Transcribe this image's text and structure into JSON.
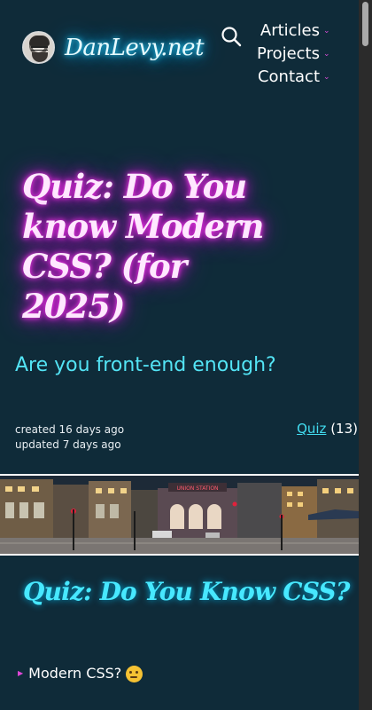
{
  "header": {
    "site_name": "DanLevy.net",
    "avatar_alt": "avatar",
    "nav": [
      {
        "label": "Articles"
      },
      {
        "label": "Projects"
      },
      {
        "label": "Contact"
      }
    ]
  },
  "hero": {
    "title": "Quiz: Do You know Modern CSS? (for 2025)",
    "subtitle": "Are you front-end enough?",
    "created": "created 16 days ago",
    "updated": "updated 7 days ago",
    "tag_label": "Quiz",
    "tag_count": "(13)"
  },
  "content": {
    "section_title": "Quiz: Do You Know CSS?",
    "list": [
      {
        "label": "Modern CSS?",
        "emoji": "thinking-face-icon"
      }
    ]
  },
  "colors": {
    "background": "#0f2b39",
    "accent_cyan": "#47e8ff",
    "accent_pink": "#e21be0"
  }
}
